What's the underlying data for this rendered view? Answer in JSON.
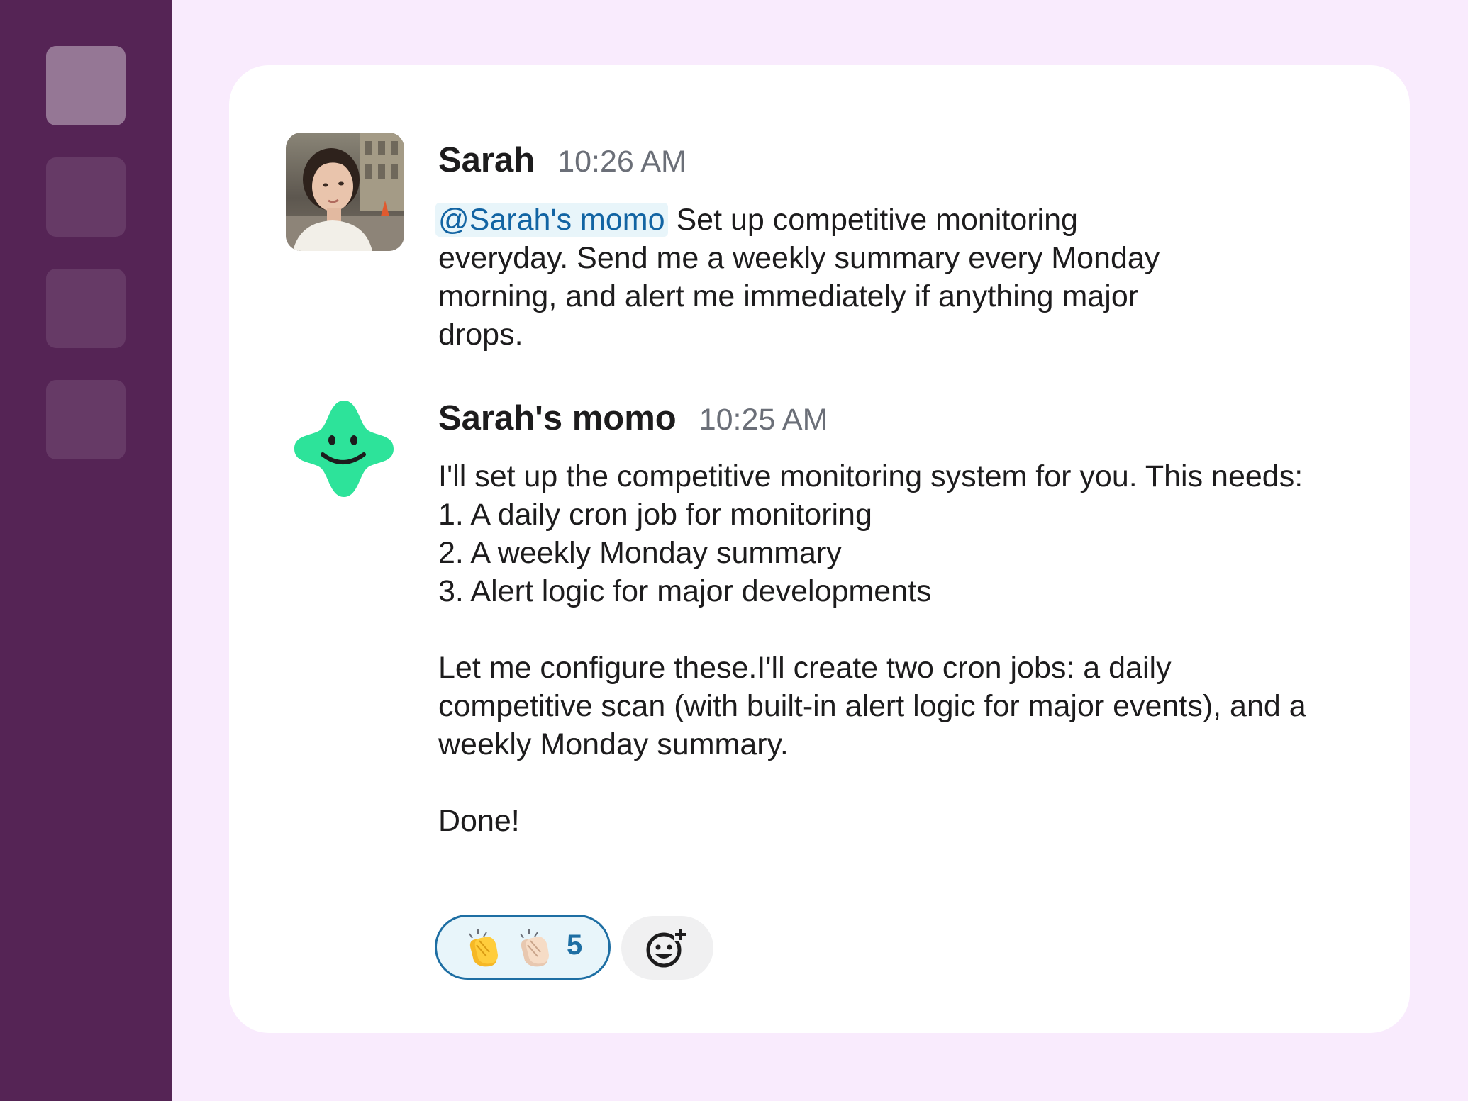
{
  "workspace": {
    "tiles": [
      "workspace-1",
      "workspace-2",
      "workspace-3",
      "workspace-4"
    ],
    "active_index": 0
  },
  "messages": [
    {
      "sender": "Sarah",
      "time": "10:26 AM",
      "avatar": "user-photo",
      "mention": "@Sarah's momo",
      "text": " Set up competitive monitoring everyday. Send me a weekly summary every Monday morning, and alert me immediately if anything major drops."
    },
    {
      "sender": "Sarah's momo",
      "time": "10:25 AM",
      "avatar": "momo-bot-icon",
      "lines": [
        "I'll set up the competitive monitoring system for you. This needs:",
        "1. A daily cron job for monitoring",
        "2. A weekly Monday summary",
        "3. Alert logic for major developments",
        "",
        "Let me configure these.I'll create two cron jobs: a daily competitive scan (with built-in alert logic for major events), and a weekly Monday summary.",
        "",
        "Done!"
      ]
    }
  ],
  "reactions": [
    {
      "emoji": [
        "clapping-hands-yellow",
        "clapping-hands-light"
      ],
      "count": "5",
      "selected": true
    }
  ],
  "add_reaction": {
    "icon": "add-reaction-icon"
  },
  "colors": {
    "sidebar": "#552455",
    "background": "#f9ebfd",
    "mention": "#1264a3",
    "mention_bg": "#e8f5fa",
    "bot_green": "#2de39a",
    "reaction_border": "#1d6ea3"
  }
}
